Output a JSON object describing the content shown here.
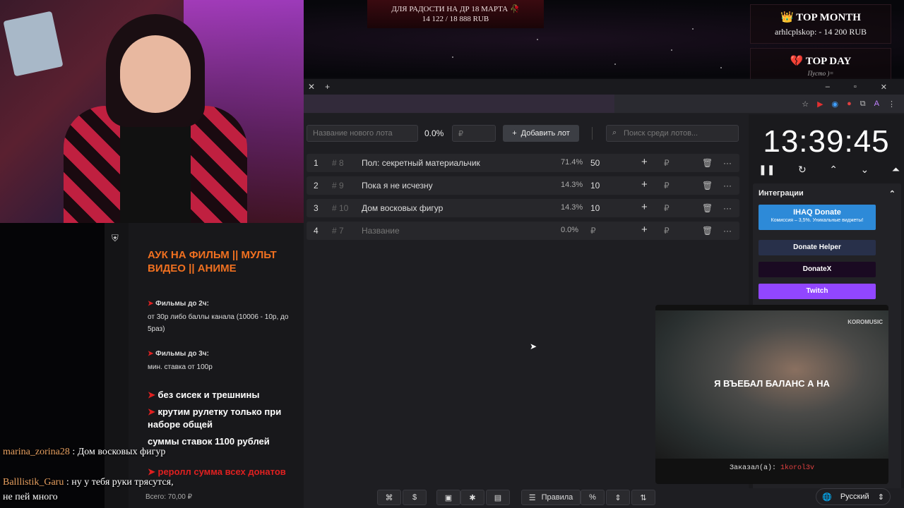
{
  "overlay": {
    "goal_line1": "ДЛЯ РАДОСТИ НА ДР 18 МАРТА 🥀",
    "goal_line2": "14 122 / 18 888 RUB",
    "top_month_title": "👑 TOP MONTH",
    "top_month_value": "arhlcplskop: - 14 200 RUB",
    "top_day_title": "💔 TOP DAY",
    "top_day_value": "Пусто )="
  },
  "browser": {
    "tab_close": "✕",
    "tab_new": "+",
    "win_min": "–",
    "win_max": "▫",
    "win_close": "✕"
  },
  "lot_form": {
    "name_placeholder": "Название нового лота",
    "percent": "0.0%",
    "amount_placeholder": "₽",
    "add_button": "Добавить лот",
    "search_placeholder": "Поиск среди лотов..."
  },
  "lots": [
    {
      "num": "1",
      "id": "# 8",
      "name": "Пол: секретный материальчик",
      "pct": "71.4%",
      "amount": "50",
      "rub": "₽"
    },
    {
      "num": "2",
      "id": "# 9",
      "name": "Пока я не исчезну",
      "pct": "14.3%",
      "amount": "10",
      "rub": "₽"
    },
    {
      "num": "3",
      "id": "# 10",
      "name": "Дом восковых фигур",
      "pct": "14.3%",
      "amount": "10",
      "rub": "₽"
    },
    {
      "num": "4",
      "id": "# 7",
      "name": "Название",
      "pct": "0.0%",
      "amount": "₽",
      "rub": "₽"
    }
  ],
  "timer": {
    "clock": "13:39:45"
  },
  "integrations": {
    "title": "Интеграции",
    "ihaq_title": "IHAQ Donate",
    "ihaq_sub": "Комиссия – 3,5%. Уникальные виджеты!",
    "donate_helper": "Donate Helper",
    "donatex": "DonateX",
    "twitch": "Twitch"
  },
  "video": {
    "caption": "Я ВЪЕБАЛ БАЛАНС А НА",
    "watermark": "KOROMUSIC",
    "ordered_label": "Заказал(а):",
    "ordered_by": "1korol3v"
  },
  "description": {
    "title": "АУК НА ФИЛЬМ || МУЛЬТ ВИДЕО || АНИМЕ",
    "films2h_head": "Фильмы до 2ч:",
    "films2h_text": "от 30р либо баллы канала (10006 - 10р, до 5раз)",
    "films3h_head": "Фильмы до 3ч:",
    "films3h_text": "мин. ставка от 100р",
    "rule1": "без сисек и трешнины",
    "rule2": "крутим рулетку только при наборе общей",
    "rule3": "суммы ставок 1100 рублей",
    "rule4": "реролл сумма всех донатов"
  },
  "chat": [
    {
      "user": "marina_zorina28",
      "text": "Дом восковых фигур"
    },
    {
      "user": "Balllistik_Garu",
      "text": "ну у тебя руки трясутся, не пей много"
    }
  ],
  "footer": {
    "total": "Всего: 70,00 ₽",
    "rules_button": "Правила",
    "percent_button": "%",
    "language": "Русский"
  },
  "colors": {
    "accent_orange": "#f07020",
    "twitch": "#9146ff",
    "ihaq": "#2d8ad8"
  }
}
